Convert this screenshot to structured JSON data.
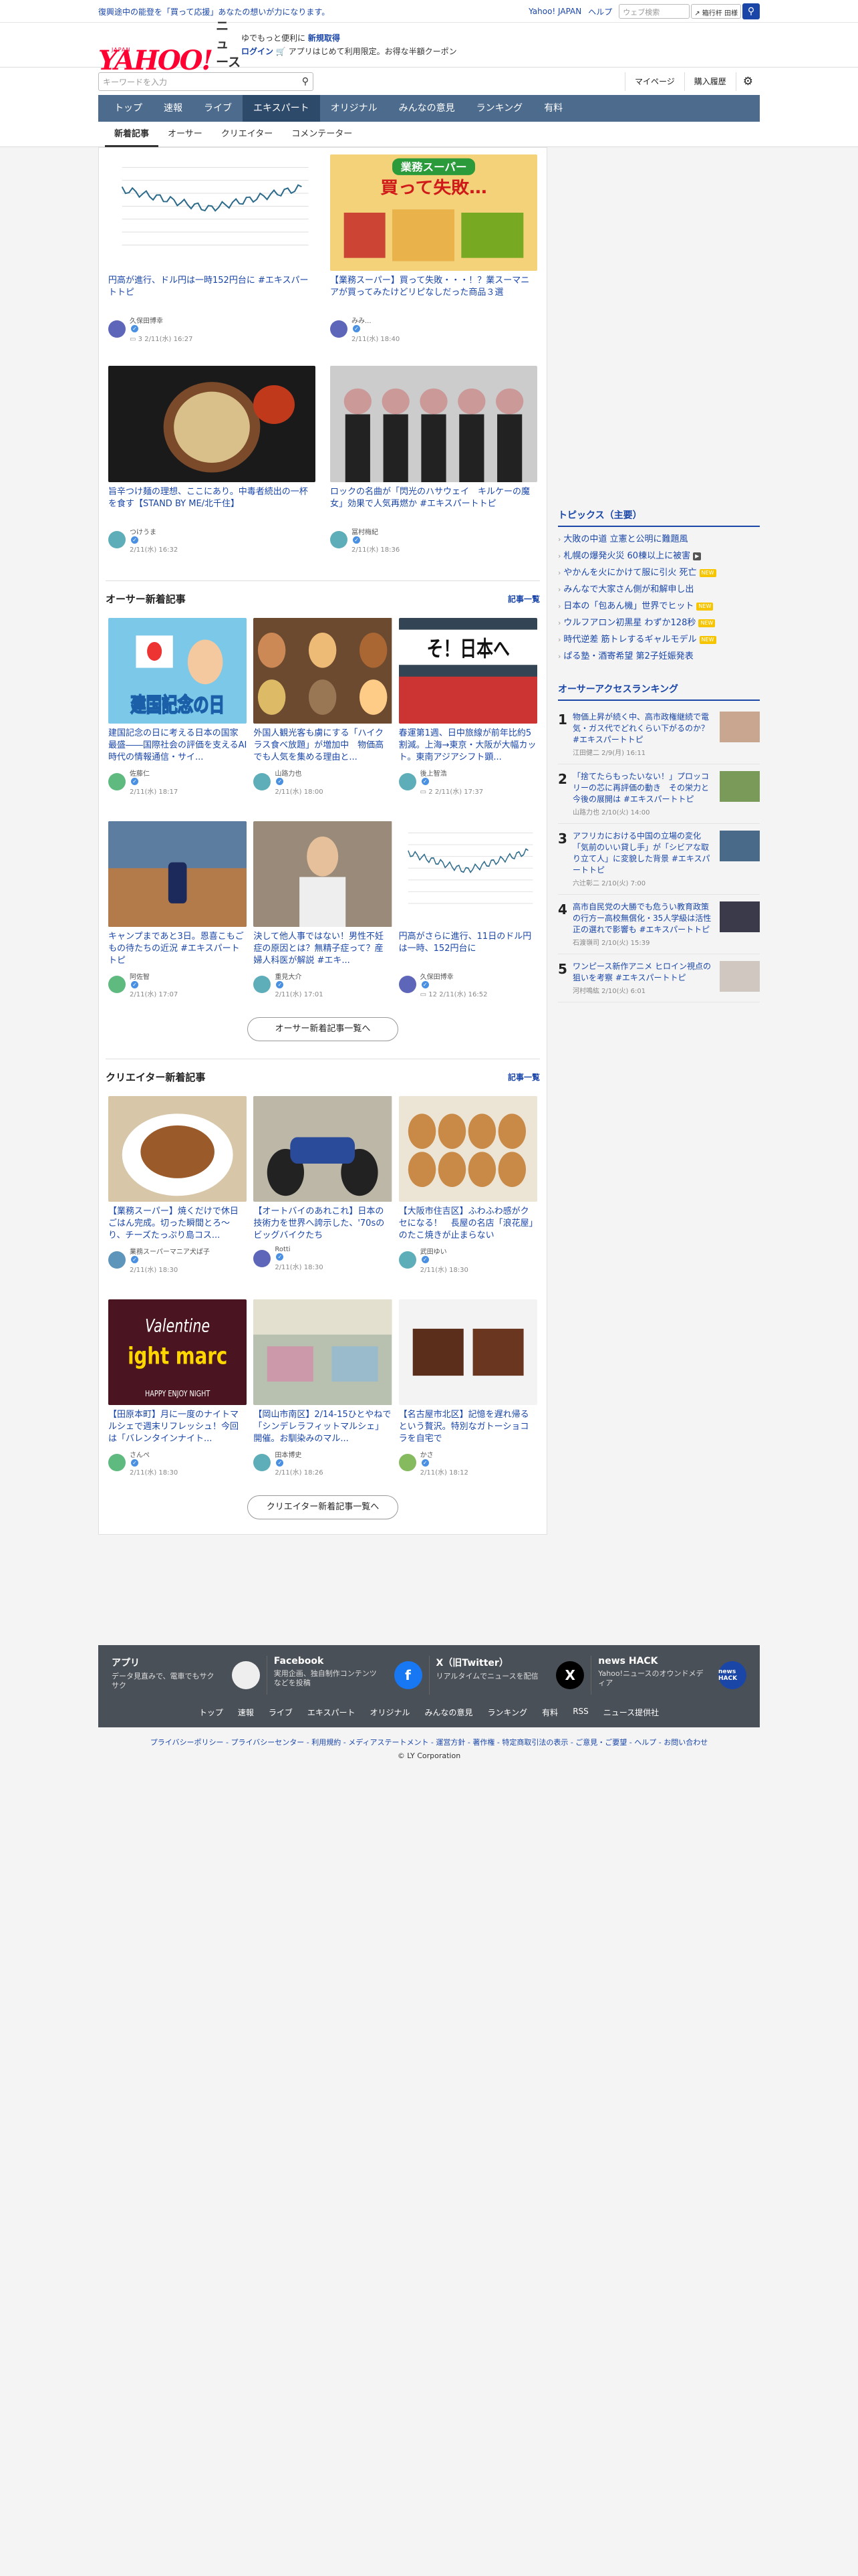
{
  "topbar": {
    "promo": "復興途中の能登を「買って応援」あなたの想いが力になります。",
    "links": [
      "Yahoo! JAPAN",
      "ヘルプ"
    ],
    "search_placeholder": "ウェブ検索",
    "hot": "↗ 箱行杆 田様",
    "search_icon": "search-icon"
  },
  "mast": {
    "logo_main": "YAHOO!",
    "logo_sub": "JAPAN",
    "logo_news": "ニュース",
    "line1": "ゆでもっと便利に",
    "line1_bold": "新規取得",
    "line2_bold": "ログイン",
    "line2": "🛒 アプリはじめて利用限定。お得な半額クーポン"
  },
  "searchrow": {
    "placeholder": "キーワードを入力",
    "mypage": "マイページ",
    "history": "購入履歴"
  },
  "nav": [
    "トップ",
    "速報",
    "ライブ",
    "エキスパート",
    "オリジナル",
    "みんなの意見",
    "ランキング",
    "有料"
  ],
  "nav_active": 3,
  "subnav": [
    "新着記事",
    "オーサー",
    "クリエイター",
    "コメンテーター"
  ],
  "subnav_active": 0,
  "top_articles": [
    {
      "title": "円高が進行、ドル円は一時152円台に #エキスパートトピ",
      "author": "久保田博幸",
      "date": "2/11(水) 16:27",
      "comments": "3",
      "thumb": "chart"
    },
    {
      "title": "【業務スーパー】買って失敗・・・！？業スーマニアが買ってみたけどリピなしだった商品３選",
      "author": "みみ...",
      "date": "2/11(水) 18:40",
      "comments": "",
      "thumb": "gyomu",
      "thumb_label": "業務スーパー",
      "thumb_big": "買って失敗…"
    },
    {
      "title": "旨辛つけ麺の理想、ここにあり。中毒者続出の一杯を食す【STAND BY ME/北千住】",
      "author": "つけうま",
      "date": "2/11(水) 16:32",
      "comments": "",
      "thumb": "ramen"
    },
    {
      "title": "ロックの名曲が「閃光のハサウェイ　キルケーの魔女」効果で人気再燃か #エキスパートトピ",
      "author": "冨村梅紀",
      "date": "2/11(水) 18:36",
      "comments": "",
      "thumb": "band"
    }
  ],
  "owner": {
    "heading": "オーサー新着記事",
    "more": "記事一覧",
    "button": "オーサー新着記事一覧へ",
    "articles": [
      {
        "title": "建国記念の日に考える日本の国家最盛――国際社会の評価を支えるAI時代の情報通信・サイ...",
        "author": "佐藤仁",
        "date": "2/11(水) 18:17",
        "comments": "",
        "thumb": "kenkoku",
        "thumb_text": "建国記念の日"
      },
      {
        "title": "外国人観光客も虜にする「ハイクラス食べ放題」が増加中　物価高でも人気を集める理由と...",
        "author": "山路力也",
        "date": "2/11(水) 18:00",
        "comments": "",
        "thumb": "buffet"
      },
      {
        "title": "春運第1週、日中旅線が前年比約5割減。上海→東京・大阪が大幅カット。東南アジアシフト顕...",
        "author": "後上智浩",
        "date": "2/11(水) 17:37",
        "comments": "2",
        "thumb": "travel",
        "thumb_text": "そ！日本へ"
      },
      {
        "title": "キャンプまであと3日。恩喜こもごもの待たちの近況 #エキスパートトピ",
        "author": "阿佐智",
        "date": "2/11(水) 17:07",
        "comments": "",
        "thumb": "stadium"
      },
      {
        "title": "決して他人事ではない！男性不妊症の原因とは？無精子症って？産婦人科医が解説 #エキ...",
        "author": "重見大介",
        "date": "2/11(水) 17:01",
        "comments": "",
        "thumb": "man"
      },
      {
        "title": "円高がさらに進行、11日のドル円は一時、152円台に",
        "author": "久保田博幸",
        "date": "2/11(水) 16:52",
        "comments": "12",
        "thumb": "chart2"
      }
    ]
  },
  "creator": {
    "heading": "クリエイター新着記事",
    "more": "記事一覧",
    "button": "クリエイター新着記事一覧へ",
    "articles": [
      {
        "title": "【業務スーパー】焼くだけで休日ごはん完成。切った瞬間とろ〜り、チーズたっぷり島コス...",
        "author": "業務スーパーマニア犬ぱ子",
        "date": "2/11(水) 18:30",
        "thumb": "cheese"
      },
      {
        "title": "【オートバイのあれこれ】日本の技術力を世界へ誇示した、'70sのビッグバイクたち",
        "author": "Rotti",
        "date": "2/11(水) 18:30",
        "thumb": "bike"
      },
      {
        "title": "【大阪市住吉区】ふわふわ感がクセになる！　長屋の名店「浪花屋」のたこ焼きが止まらない",
        "author": "武田ゆい",
        "date": "2/11(水) 18:30",
        "thumb": "takoyaki"
      },
      {
        "title": "【田原本町】月に一度のナイトマルシェで週末リフレッシュ！今回は「バレンタインナイト...",
        "author": "さんぺ",
        "date": "2/11(水) 18:30",
        "thumb": "valentine",
        "thumb_text1": "Valentine",
        "thumb_text2": "ight marc",
        "thumb_text3": "HAPPY ENJOY NIGHT"
      },
      {
        "title": "【岡山市南区】2/14-15ひとやねで「シンデレラフィットマルシェ」開催。お馴染みのマル...",
        "author": "田本博史",
        "date": "2/11(水) 18:26",
        "thumb": "market"
      },
      {
        "title": "【名古屋市北区】記憶を遅れ帰るという贅沢。特別なガトーショコラを自宅で",
        "author": "かさ",
        "date": "2/11(水) 18:12",
        "thumb": "choco"
      }
    ]
  },
  "topics": {
    "heading": "トピックス（主要）",
    "items": [
      {
        "text": "大敗の中道 立憲と公明に難題風",
        "tag": ""
      },
      {
        "text": "札幌の爆発火災 60棟以上に被害",
        "tag": "cam"
      },
      {
        "text": "やかんを火にかけて服に引火 死亡",
        "tag": "new"
      },
      {
        "text": "みんなで大家さん側が和解申し出",
        "tag": ""
      },
      {
        "text": "日本の「包あん機」世界でヒット",
        "tag": "new"
      },
      {
        "text": "ウルフアロン初黒星 わずか128秒",
        "tag": "new"
      },
      {
        "text": "時代逆差 筋トレするギャルモデル",
        "tag": "new"
      },
      {
        "text": "ぱる塾・酒寄希望 第2子妊娠発表",
        "tag": ""
      }
    ],
    "new_label": "NEW",
    "cam_label": "▶"
  },
  "ranking": {
    "heading": "オーサーアクセスランキング",
    "items": [
      {
        "no": "1",
        "title": "物価上昇が続く中、高市政権継続で電気・ガス代でどれくらい下がるのか？ #エキスパートトピ",
        "meta": "江田健二 2/9(月) 16:11"
      },
      {
        "no": "2",
        "title": "「捨てたらもったいない！」プロッコリーの芯に再評価の動き　その栄力と今後の展開は #エキスパートトピ",
        "meta": "山路力也 2/10(火) 14:00"
      },
      {
        "no": "3",
        "title": "アフリカにおける中国の立場の変化　「気前のいい貸し手」が「シビアな取り立て人」に変貌した背景 #エキスパートトピ",
        "meta": "六辻彰二 2/10(火) 7:00"
      },
      {
        "no": "4",
        "title": "高市自民党の大勝でも危うい教育政策の行方ー高校無償化・35人学級は活性正の選れで影響も #エキスパートトピ",
        "meta": "石渡嶺司 2/10(火) 15:39"
      },
      {
        "no": "5",
        "title": "ワンピース新作アニメ ヒロイン視点の狙いを考察 #エキスパートトピ",
        "meta": "河村鳴紘 2/10(火) 6:01"
      }
    ]
  },
  "footer": {
    "apps": [
      {
        "name": "アプリ",
        "desc": "データ見直みで、電車でもサクサク",
        "icon": "app-icon"
      },
      {
        "name": "Facebook",
        "desc": "実用企画、独自制作コンテンツなどを投稿",
        "icon": "facebook-icon",
        "glyph": "f"
      },
      {
        "name": "X（旧Twitter）",
        "desc": "リアルタイムでニュースを配信",
        "icon": "x-icon",
        "glyph": "X"
      },
      {
        "name": "news HACK",
        "desc": "Yahoo!ニュースのオウンドメディア",
        "icon": "newshack-icon",
        "glyph": "news HACK"
      }
    ],
    "links": [
      "トップ",
      "速報",
      "ライブ",
      "エキスパート",
      "オリジナル",
      "みんなの意見",
      "ランキング",
      "有料",
      "RSS",
      "ニュース提供社"
    ],
    "legal": "プライバシーポリシー - プライバシーセンター - 利用規約 - メディアステートメント - 運営方針 - 著作権 - 特定商取引法の表示 - ご意見・ご要望 - ヘルプ - お問い合わせ",
    "copyright": "© LY Corporation"
  }
}
